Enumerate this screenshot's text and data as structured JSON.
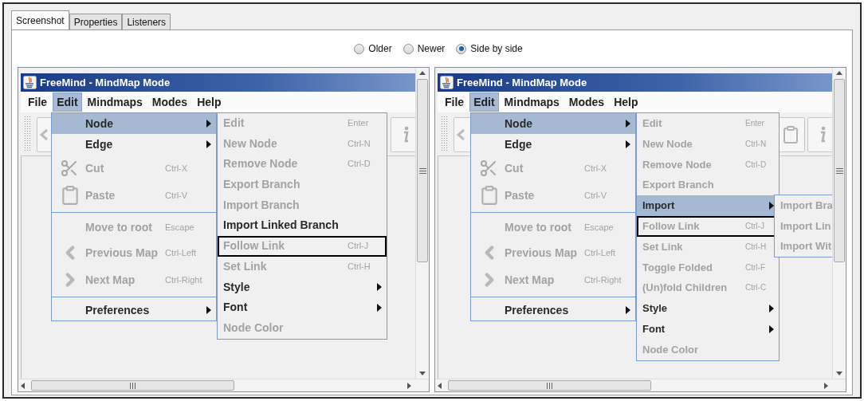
{
  "tabs": [
    {
      "label": "Screenshot",
      "selected": true
    },
    {
      "label": "Properties",
      "selected": false
    },
    {
      "label": "Listeners",
      "selected": false
    }
  ],
  "view_options": [
    {
      "label": "Older",
      "selected": false
    },
    {
      "label": "Newer",
      "selected": false
    },
    {
      "label": "Side by side",
      "selected": true
    }
  ],
  "panes": [
    {
      "window_title": "FreeMind - MindMap Mode",
      "menubar": [
        {
          "label": "File",
          "selected": false
        },
        {
          "label": "Edit",
          "selected": true
        },
        {
          "label": "Mindmaps",
          "selected": false
        },
        {
          "label": "Modes",
          "selected": false
        },
        {
          "label": "Help",
          "selected": false
        }
      ],
      "menus": [
        {
          "items": [
            {
              "kind": "submenu",
              "label": "Node",
              "disabled": false,
              "selected": true
            },
            {
              "kind": "submenu",
              "label": "Edge",
              "disabled": false,
              "selected": false
            },
            {
              "kind": "cut",
              "label": "Cut",
              "shortcut": "Ctrl-X",
              "disabled": true,
              "selected": false
            },
            {
              "kind": "paste",
              "label": "Paste",
              "shortcut": "Ctrl-V",
              "disabled": true,
              "selected": false
            },
            {
              "kind": "separator"
            },
            {
              "kind": "command",
              "label": "Move to root",
              "shortcut": "Escape",
              "disabled": true,
              "selected": false
            },
            {
              "kind": "previous",
              "label": "Previous Map",
              "shortcut": "Ctrl-Left",
              "disabled": true,
              "selected": false
            },
            {
              "kind": "next",
              "label": "Next Map",
              "shortcut": "Ctrl-Right",
              "disabled": true,
              "selected": false
            },
            {
              "kind": "separator"
            },
            {
              "kind": "submenu",
              "label": "Preferences",
              "disabled": false,
              "selected": false
            }
          ]
        },
        {
          "items": [
            {
              "kind": "command",
              "label": "Edit",
              "shortcut": "Enter",
              "disabled": true,
              "selected": false,
              "outlined": false
            },
            {
              "kind": "command",
              "label": "New Node",
              "shortcut": "Ctrl-N",
              "disabled": true,
              "selected": false,
              "outlined": false
            },
            {
              "kind": "command",
              "label": "Remove Node",
              "shortcut": "Ctrl-D",
              "disabled": true,
              "selected": false,
              "outlined": false
            },
            {
              "kind": "command",
              "label": "Export Branch",
              "disabled": true,
              "selected": false,
              "outlined": false
            },
            {
              "kind": "command",
              "label": "Import Branch",
              "disabled": true,
              "selected": false,
              "outlined": false
            },
            {
              "kind": "command",
              "label": "Import Linked Branch",
              "disabled": false,
              "selected": false,
              "outlined": false
            },
            {
              "kind": "command",
              "label": "Follow Link",
              "shortcut": "Ctrl-J",
              "disabled": true,
              "selected": false,
              "outlined": true
            },
            {
              "kind": "command",
              "label": "Set Link",
              "shortcut": "Ctrl-H",
              "disabled": true,
              "selected": false,
              "outlined": false
            },
            {
              "kind": "submenu",
              "label": "Style",
              "disabled": false,
              "selected": false,
              "outlined": false
            },
            {
              "kind": "submenu",
              "label": "Font",
              "disabled": false,
              "selected": false,
              "outlined": false
            },
            {
              "kind": "command",
              "label": "Node Color",
              "disabled": true,
              "selected": false,
              "outlined": false
            }
          ]
        }
      ]
    },
    {
      "window_title": "FreeMind - MindMap Mode",
      "menubar": [
        {
          "label": "File",
          "selected": false
        },
        {
          "label": "Edit",
          "selected": true
        },
        {
          "label": "Mindmaps",
          "selected": false
        },
        {
          "label": "Modes",
          "selected": false
        },
        {
          "label": "Help",
          "selected": false
        }
      ],
      "menus": [
        {
          "items": [
            {
              "kind": "submenu",
              "label": "Node",
              "disabled": false,
              "selected": true
            },
            {
              "kind": "submenu",
              "label": "Edge",
              "disabled": false,
              "selected": false
            },
            {
              "kind": "cut",
              "label": "Cut",
              "shortcut": "Ctrl-X",
              "disabled": true,
              "selected": false
            },
            {
              "kind": "paste",
              "label": "Paste",
              "shortcut": "Ctrl-V",
              "disabled": true,
              "selected": false
            },
            {
              "kind": "separator"
            },
            {
              "kind": "command",
              "label": "Move to root",
              "shortcut": "Escape",
              "disabled": true,
              "selected": false
            },
            {
              "kind": "previous",
              "label": "Previous Map",
              "shortcut": "Ctrl-Left",
              "disabled": true,
              "selected": false
            },
            {
              "kind": "next",
              "label": "Next Map",
              "shortcut": "Ctrl-Right",
              "disabled": true,
              "selected": false
            },
            {
              "kind": "separator"
            },
            {
              "kind": "submenu",
              "label": "Preferences",
              "disabled": false,
              "selected": false
            }
          ]
        },
        {
          "items": [
            {
              "kind": "command",
              "label": "Edit",
              "shortcut": "Enter",
              "disabled": true,
              "selected": false,
              "outlined": false
            },
            {
              "kind": "command",
              "label": "New Node",
              "shortcut": "Ctrl-N",
              "disabled": true,
              "selected": false,
              "outlined": false
            },
            {
              "kind": "command",
              "label": "Remove Node",
              "shortcut": "Ctrl-D",
              "disabled": true,
              "selected": false,
              "outlined": false
            },
            {
              "kind": "command",
              "label": "Export Branch",
              "disabled": true,
              "selected": false,
              "outlined": false
            },
            {
              "kind": "submenu",
              "label": "Import",
              "disabled": false,
              "selected": true,
              "outlined": false
            },
            {
              "kind": "command",
              "label": "Follow Link",
              "shortcut": "Ctrl-J",
              "disabled": true,
              "selected": false,
              "outlined": true
            },
            {
              "kind": "command",
              "label": "Set Link",
              "shortcut": "Ctrl-H",
              "disabled": true,
              "selected": false,
              "outlined": false
            },
            {
              "kind": "command",
              "label": "Toggle Folded",
              "shortcut": "Ctrl-F",
              "disabled": true,
              "selected": false,
              "outlined": false
            },
            {
              "kind": "command",
              "label": "(Un)fold Children",
              "shortcut": "Ctrl-C",
              "disabled": true,
              "selected": false,
              "outlined": false
            },
            {
              "kind": "submenu",
              "label": "Style",
              "disabled": false,
              "selected": false,
              "outlined": false
            },
            {
              "kind": "submenu",
              "label": "Font",
              "disabled": false,
              "selected": false,
              "outlined": false
            },
            {
              "kind": "command",
              "label": "Node Color",
              "disabled": true,
              "selected": false,
              "outlined": false
            }
          ]
        },
        {
          "items": [
            {
              "kind": "command",
              "label": "Import Bra",
              "disabled": true,
              "selected": false
            },
            {
              "kind": "command",
              "label": "Import Lin",
              "disabled": true,
              "selected": false
            },
            {
              "kind": "command",
              "label": "Import Wit",
              "disabled": true,
              "selected": false
            }
          ]
        }
      ]
    }
  ]
}
